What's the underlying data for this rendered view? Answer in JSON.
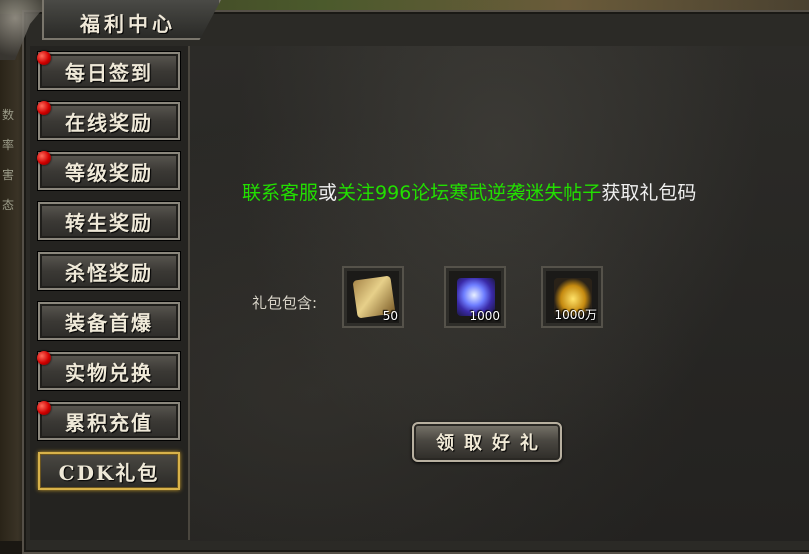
{
  "window": {
    "title": "福利中心"
  },
  "background": {
    "side_glyphs": [
      "数",
      "率",
      "害",
      "态"
    ]
  },
  "sidebar": {
    "items": [
      {
        "label": "每日签到",
        "badge": true,
        "active": false
      },
      {
        "label": "在线奖励",
        "badge": true,
        "active": false
      },
      {
        "label": "等级奖励",
        "badge": true,
        "active": false
      },
      {
        "label": "转生奖励",
        "badge": false,
        "active": false
      },
      {
        "label": "杀怪奖励",
        "badge": false,
        "active": false
      },
      {
        "label": "装备首爆",
        "badge": false,
        "active": false
      },
      {
        "label": "实物兑换",
        "badge": true,
        "active": false
      },
      {
        "label": "累积充值",
        "badge": true,
        "active": false
      },
      {
        "label": "CDK礼包",
        "badge": false,
        "active": true
      }
    ]
  },
  "main": {
    "notice": {
      "part1": "联系客服",
      "part2": "或",
      "part3": "关注996论坛寒武逆袭迷失帖子",
      "part4": "获取礼包码"
    },
    "pack_label": "礼包包含:",
    "rewards": [
      {
        "icon": "scroll-icon",
        "qty": "50"
      },
      {
        "icon": "blue-gem-icon",
        "qty": "1000"
      },
      {
        "icon": "gold-ingot-icon",
        "qty": "1000万"
      }
    ],
    "claim_button": "领取好礼"
  },
  "colors": {
    "highlight_green": "#22e000",
    "active_border": "#d8b24a",
    "badge_red": "#d10000"
  }
}
